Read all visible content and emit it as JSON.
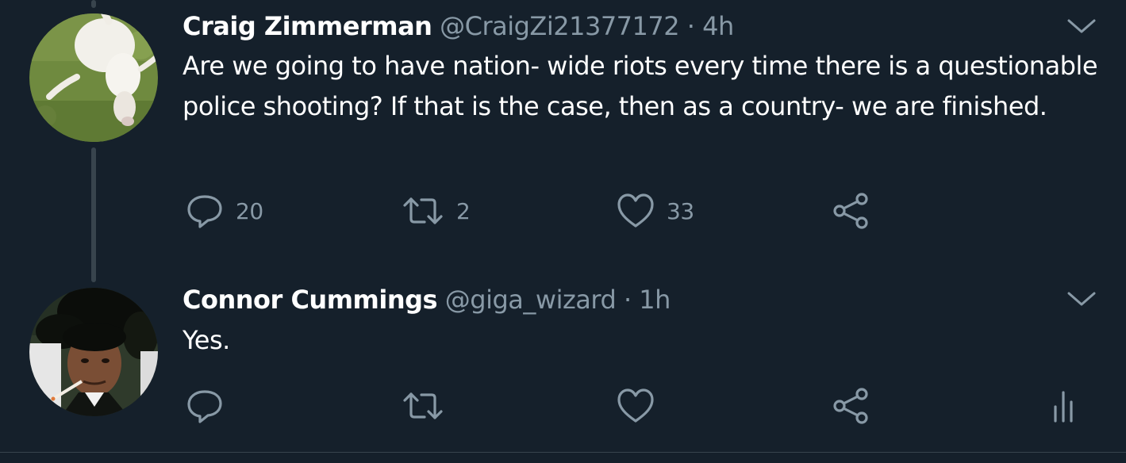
{
  "tweets": [
    {
      "name": "Craig Zimmerman",
      "handle": "@CraigZi21377172",
      "separator": "·",
      "time": "4h",
      "text": "Are we going to have nation- wide riots every time there is a questionable police shooting? If that is the case, then as a country- we are finished.",
      "avatar": "sheep-avatar",
      "replies": "20",
      "retweets": "2",
      "likes": "33"
    },
    {
      "name": "Connor Cummings",
      "handle": "@giga_wizard",
      "separator": "·",
      "time": "1h",
      "text": "Yes.",
      "avatar": "person-smoking-avatar",
      "replies": "",
      "retweets": "",
      "likes": ""
    }
  ],
  "icons": {
    "reply": "reply-icon",
    "retweet": "retweet-icon",
    "like": "heart-icon",
    "share": "share-icon",
    "menu": "chevron-down-icon",
    "analytics": "analytics-icon"
  },
  "colors": {
    "background": "#15202b",
    "secondary_text": "#8899a6",
    "thread_line": "#38444d"
  }
}
